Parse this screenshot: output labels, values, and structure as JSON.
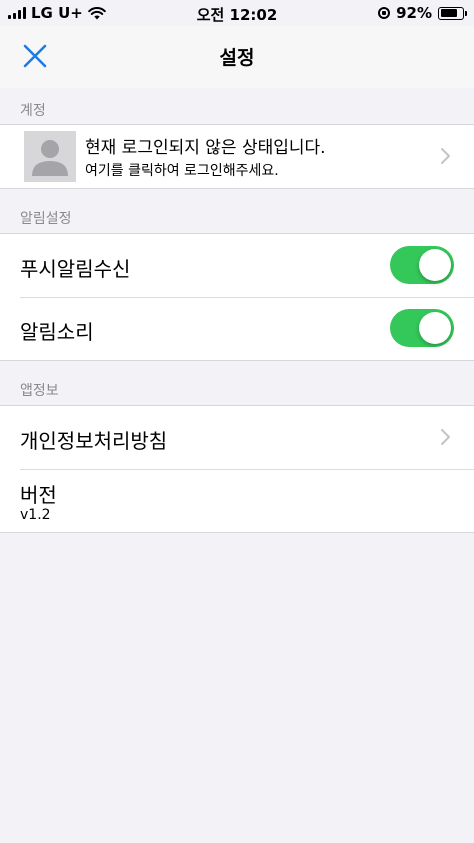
{
  "status_bar": {
    "carrier": "LG U+",
    "time": "오전 12:02",
    "battery": "92%",
    "battery_level": 0.92,
    "icons": [
      "signal-icon",
      "wifi-icon",
      "rotation-lock-icon",
      "battery-icon"
    ]
  },
  "nav": {
    "title": "설정",
    "close_icon": "close-icon",
    "accent_color": "#1e7be6"
  },
  "account": {
    "header": "계정",
    "title": "현재 로그인되지 않은 상태입니다.",
    "subtitle": "여기를 클릭하여 로그인해주세요."
  },
  "notifications": {
    "header": "알림설정",
    "items": [
      {
        "label": "푸시알림수신",
        "enabled": true
      },
      {
        "label": "알림소리",
        "enabled": true
      }
    ],
    "toggle_color": "#34c759"
  },
  "app_info": {
    "header": "앱정보",
    "privacy_label": "개인정보처리방침",
    "version_label": "버전",
    "version_value": "v1.2"
  }
}
